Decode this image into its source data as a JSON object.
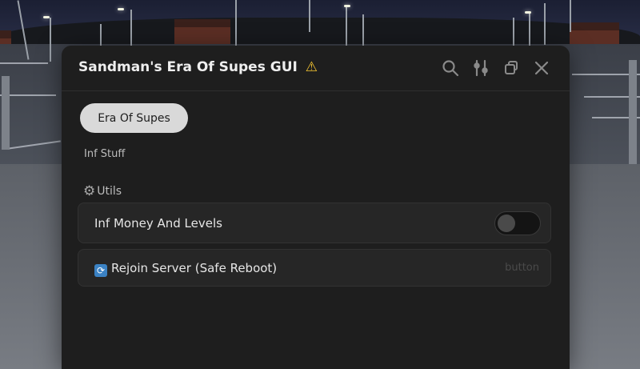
{
  "window": {
    "title": "Sandman's Era Of Supes GUI",
    "title_icon": "warning-icon"
  },
  "toolbar": {
    "icons": [
      "search-icon",
      "sliders-icon",
      "restore-window-icon",
      "close-icon"
    ]
  },
  "tabs": [
    {
      "label": "Era Of Supes",
      "selected": true
    }
  ],
  "section": {
    "label": "Inf Stuff"
  },
  "group": {
    "label": "Utils",
    "icon": "gear-icon"
  },
  "rows": {
    "money": {
      "label": "Inf Money And Levels",
      "type": "toggle",
      "enabled": false
    },
    "rejoin": {
      "label": "Rejoin Server (Safe Reboot)",
      "type": "button",
      "hint": "button",
      "icon": "refresh-icon"
    }
  },
  "colors": {
    "panel": "#1e1e1e",
    "row": "#262626",
    "pill": "#d9d9d9",
    "warning": "#f4c430"
  }
}
